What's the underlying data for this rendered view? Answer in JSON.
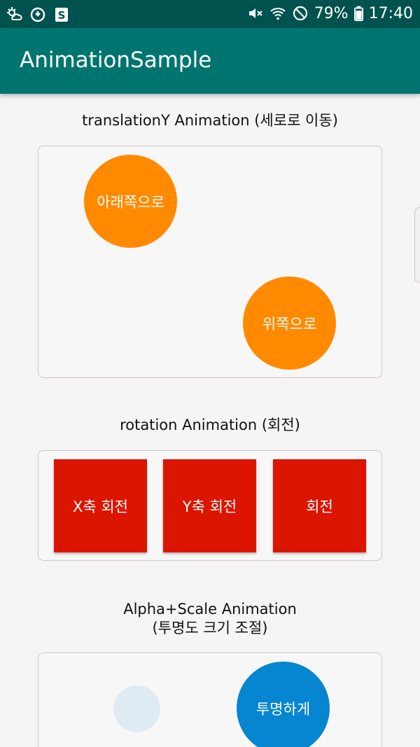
{
  "status_bar": {
    "icons_left": [
      "weather-icon",
      "sync-icon",
      "s-app-icon"
    ],
    "battery": "79%",
    "time": "17:40"
  },
  "app_bar": {
    "title": "AnimationSample"
  },
  "section_translation": {
    "title": "translationY Animation (세로로 이동)",
    "down_label": "아래쪽으로",
    "up_label": "위쪽으로"
  },
  "section_rotation": {
    "title": "rotation Animation (회전)",
    "x_label": "X축 회전",
    "y_label": "Y축 회전",
    "rotate_label": "회전"
  },
  "section_alpha": {
    "title_line1": "Alpha+Scale Animation",
    "title_line2": "(투명도 크기 조절)",
    "transparent_label": "투명하게"
  },
  "colors": {
    "status_bar": "#00524f",
    "app_bar": "#00756f",
    "orange": "#ff8a00",
    "red": "#dc1500",
    "blue": "#0685d0"
  }
}
